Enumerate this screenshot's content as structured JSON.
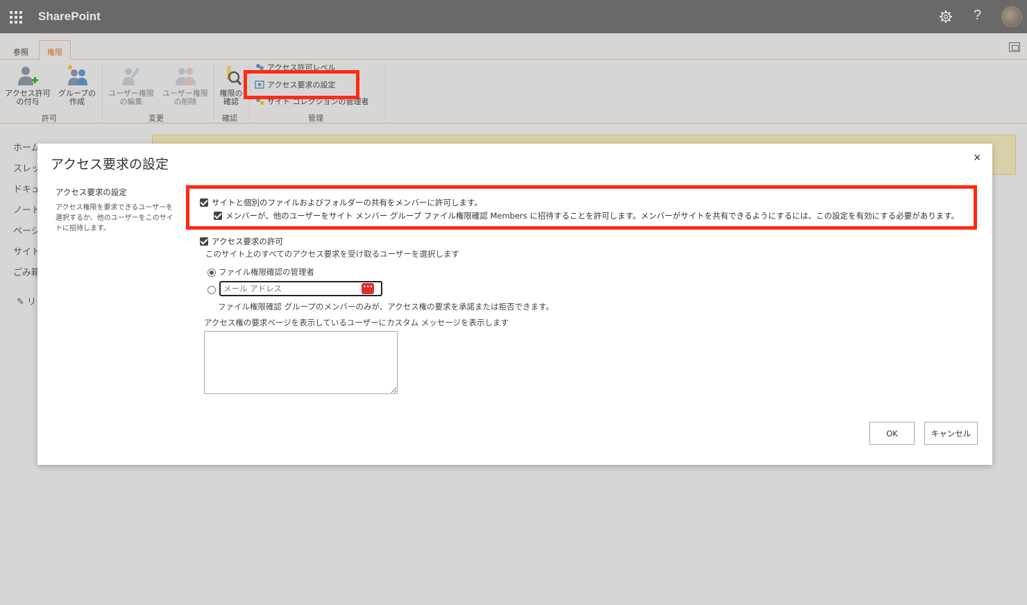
{
  "suitebar": {
    "brand": "SharePoint",
    "help": "?"
  },
  "ribbon_tabs": [
    {
      "label": "参照"
    },
    {
      "label": "権限"
    }
  ],
  "ribbon": {
    "grant_l1": "アクセス許可",
    "grant_l2": "の付与",
    "group_l1": "グループの",
    "group_l2": "作成",
    "edit_l1": "ユーザー権限",
    "edit_l2": "の編集",
    "remove_l1": "ユーザー権限",
    "remove_l2": "の削除",
    "check_l1": "権限の",
    "check_l2": "確認",
    "perm_levels": "アクセス許可レベル",
    "access_req": "アクセス要求の設定",
    "site_admins": "サイト コレクションの管理者",
    "groups": {
      "grant": "許可",
      "modify": "変更",
      "check": "確認",
      "manage": "管理"
    }
  },
  "left_nav": [
    "ホーム",
    "スレッ",
    "ドキュ",
    "ノート",
    "ページ",
    "サイト",
    "ごみ箱",
    "リ"
  ],
  "dialog": {
    "title": "アクセス要求の設定",
    "close": "×",
    "section_title": "アクセス要求の設定",
    "section_desc": "アクセス権限を要求できるユーザーを選択するか、他のユーザーをこのサイトに招待します。",
    "cb_share": "サイトと個別のファイルおよびフォルダーの共有をメンバーに許可します。",
    "cb_invite": "メンバーが、他のユーザーをサイト メンバー グループ ファイル権限確認 Members に招待することを許可します。メンバーがサイトを共有できるようにするには、この設定を有効にする必要があります。",
    "cb_allow": "アクセス要求の許可",
    "select_users": "このサイト上のすべてのアクセス要求を受け取るユーザーを選択します",
    "radio_owner": "ファイル権限確認の管理者",
    "email_placeholder": "メール アドレス",
    "note": "ファイル権限確認 グループのメンバーのみが、アクセス権の要求を承諾または拒否できます。",
    "custom_msg": "アクセス権の要求ページを表示しているユーザーにカスタム メッセージを表示します",
    "ok": "OK",
    "cancel": "キャンセル"
  },
  "colors": {
    "suitebar": "#6a6967",
    "accent": "#c86a2a",
    "highlight": "#ff2a14"
  }
}
